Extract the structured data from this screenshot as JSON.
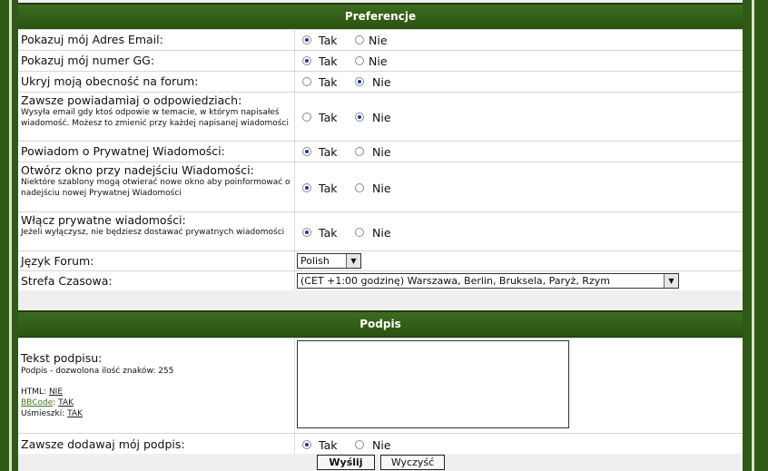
{
  "sections": {
    "preferences_title": "Preferencje",
    "signature_title": "Podpis"
  },
  "radio_labels": {
    "yes": "Tak",
    "no": "Nie"
  },
  "prefs": [
    {
      "label": "Pokazuj mój Adres Email:",
      "desc": "",
      "selected": "yes"
    },
    {
      "label": "Pokazuj mój numer GG:",
      "desc": "",
      "selected": "yes"
    },
    {
      "label": "Ukryj moją obecność na forum:",
      "desc": "",
      "selected": "no"
    },
    {
      "label": "Zawsze powiadamiaj o odpowiedziach:",
      "desc": "Wysyła email gdy ktoś odpowie w temacie, w którym napisałeś wiadomość. Możesz to zmienić przy każdej napisanej wiadomości",
      "selected": "no"
    },
    {
      "label": "Powiadom o Prywatnej Wiadomości:",
      "desc": "",
      "selected": "yes"
    },
    {
      "label": "Otwórz okno przy nadejściu Wiadomości:",
      "desc": "Niektóre szablony mogą otwierać nowe okno aby poinformować o nadejściu nowej Prywatnej Wiadomości",
      "selected": "yes"
    },
    {
      "label": "Włącz prywatne wiadomości:",
      "desc": "Jeżeli wyłączysz, nie będziesz dostawać prywatnych wiadomości",
      "selected": "yes"
    }
  ],
  "language": {
    "label": "Język Forum:",
    "value": "Polish"
  },
  "timezone": {
    "label": "Strefa Czasowa:",
    "value": "(CET +1:00 godzinę) Warszawa, Berlin, Bruksela, Paryż, Rzym"
  },
  "signature": {
    "label": "Tekst podpisu:",
    "limit": "Podpis - dozwolona ilość znaków: 255",
    "html_label": "HTML:",
    "html_value": "NIE",
    "bbcode_label": "BBCode",
    "bbcode_value": "TAK",
    "smilies_label": "Uśmieszki:",
    "smilies_value": "TAK",
    "text": ""
  },
  "always_sig": {
    "label": "Zawsze dodawaj mój podpis:",
    "selected": "yes"
  },
  "buttons": {
    "submit": "Wyślij",
    "reset": "Wyczyść"
  }
}
